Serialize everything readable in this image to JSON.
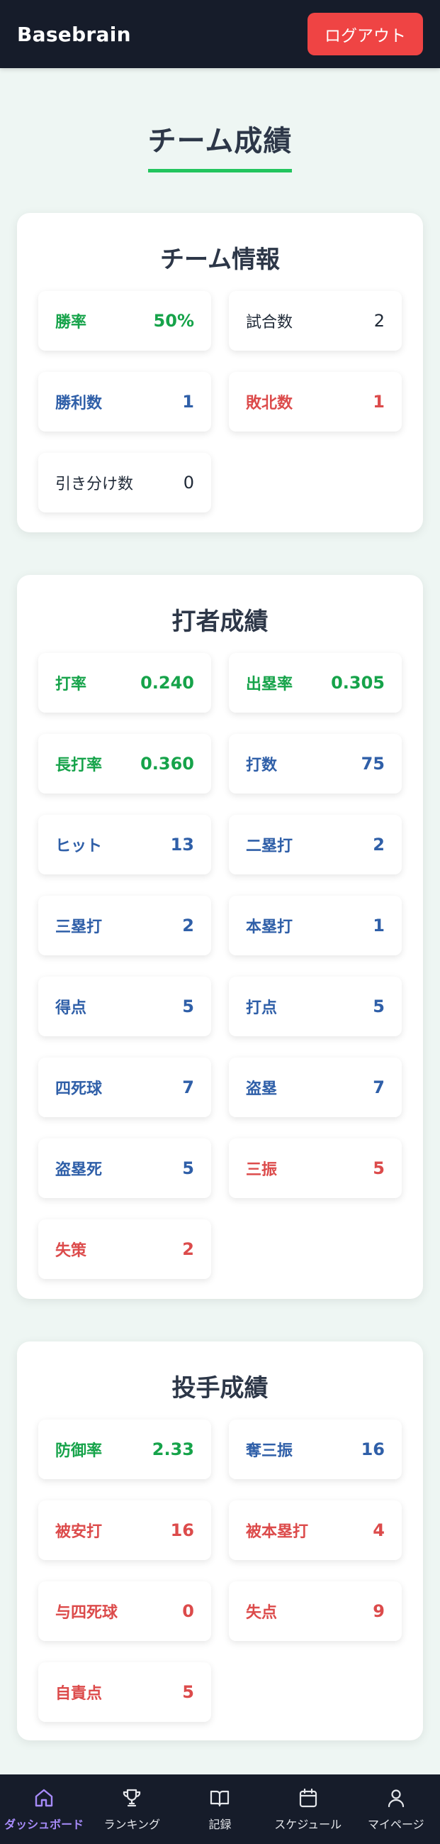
{
  "header": {
    "brand": "Basebrain",
    "logout_label": "ログアウト"
  },
  "page_title": "チーム成績",
  "team_info": {
    "title": "チーム情報",
    "stats": [
      {
        "label": "勝率",
        "value": "50%",
        "color": "green"
      },
      {
        "label": "試合数",
        "value": "2",
        "color": "dark"
      },
      {
        "label": "勝利数",
        "value": "1",
        "color": "blue"
      },
      {
        "label": "敗北数",
        "value": "1",
        "color": "red"
      },
      {
        "label": "引き分け数",
        "value": "0",
        "color": "dark"
      }
    ]
  },
  "batting": {
    "title": "打者成績",
    "stats": [
      {
        "label": "打率",
        "value": "0.240",
        "color": "green"
      },
      {
        "label": "出塁率",
        "value": "0.305",
        "color": "green"
      },
      {
        "label": "長打率",
        "value": "0.360",
        "color": "green"
      },
      {
        "label": "打数",
        "value": "75",
        "color": "blue"
      },
      {
        "label": "ヒット",
        "value": "13",
        "color": "blue"
      },
      {
        "label": "二塁打",
        "value": "2",
        "color": "blue"
      },
      {
        "label": "三塁打",
        "value": "2",
        "color": "blue"
      },
      {
        "label": "本塁打",
        "value": "1",
        "color": "blue"
      },
      {
        "label": "得点",
        "value": "5",
        "color": "blue"
      },
      {
        "label": "打点",
        "value": "5",
        "color": "blue"
      },
      {
        "label": "四死球",
        "value": "7",
        "color": "blue"
      },
      {
        "label": "盗塁",
        "value": "7",
        "color": "blue"
      },
      {
        "label": "盗塁死",
        "value": "5",
        "color": "blue"
      },
      {
        "label": "三振",
        "value": "5",
        "color": "red"
      },
      {
        "label": "失策",
        "value": "2",
        "color": "red"
      }
    ]
  },
  "pitching": {
    "title": "投手成績",
    "stats": [
      {
        "label": "防御率",
        "value": "2.33",
        "color": "green"
      },
      {
        "label": "奪三振",
        "value": "16",
        "color": "blue"
      },
      {
        "label": "被安打",
        "value": "16",
        "color": "red"
      },
      {
        "label": "被本塁打",
        "value": "4",
        "color": "red"
      },
      {
        "label": "与四死球",
        "value": "0",
        "color": "red"
      },
      {
        "label": "失点",
        "value": "9",
        "color": "red"
      },
      {
        "label": "自責点",
        "value": "5",
        "color": "red"
      }
    ]
  },
  "nav": {
    "items": [
      {
        "label": "ダッシュボード",
        "icon": "home-icon",
        "active": true
      },
      {
        "label": "ランキング",
        "icon": "trophy-icon",
        "active": false
      },
      {
        "label": "記録",
        "icon": "book-icon",
        "active": false
      },
      {
        "label": "スケジュール",
        "icon": "calendar-icon",
        "active": false
      },
      {
        "label": "マイページ",
        "icon": "user-icon",
        "active": false
      }
    ]
  },
  "colors": {
    "green": "#16a34a",
    "blue": "#2f5fa8",
    "red": "#dc4b4b",
    "dark": "#1f2937",
    "header_bg": "#161c2a",
    "logout_bg": "#ef4444",
    "accent_underline": "#22c55e",
    "nav_active": "#a78bfa"
  }
}
